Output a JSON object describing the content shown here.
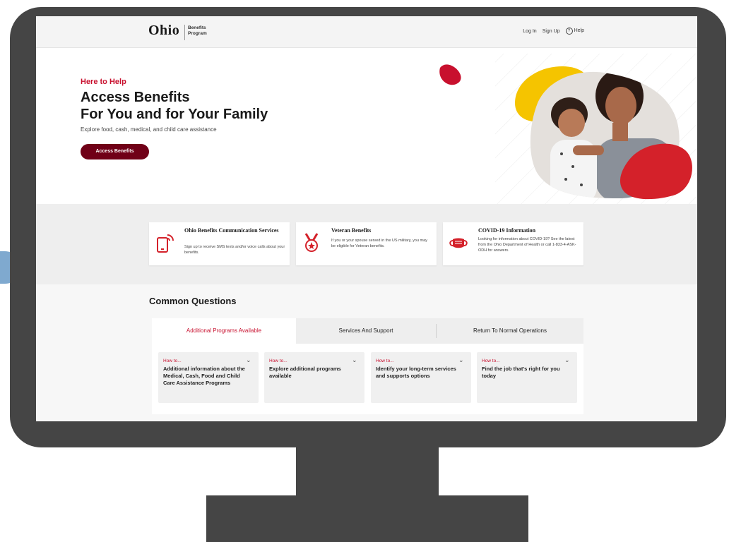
{
  "nav": {
    "logo_brand": "Ohio",
    "logo_sub_line1": "Benefits",
    "logo_sub_line2": "Program",
    "login": "Log In",
    "signup": "Sign Up",
    "help": "Help"
  },
  "hero": {
    "tagline": "Here to Help",
    "title_line1": "Access Benefits",
    "title_line2": "For You and for Your Family",
    "description": "Explore food, cash, medical, and child care assistance",
    "cta_label": "Access Benefits"
  },
  "cards": [
    {
      "title": "Ohio Benefits Communication Services",
      "description": "Sign up to receive SMS texts and/or voice calls about your benefits.",
      "icon": "phone-message-icon"
    },
    {
      "title": "Veteran Benefits",
      "description": "If you or your spouse served in the US military, you may be eligible for Veteran benefits.",
      "icon": "medal-icon"
    },
    {
      "title": "COVID-19 Information",
      "description": "Looking for information about COVID-19? See the latest from the Ohio Department of Health or call 1-833-4-ASK-ODH for answers.",
      "icon": "face-mask-icon"
    }
  ],
  "common_questions": {
    "title": "Common Questions",
    "tabs": [
      {
        "label": "Additional Programs Available",
        "active": true
      },
      {
        "label": "Services And Support",
        "active": false
      },
      {
        "label": "Return To Normal Operations",
        "active": false
      }
    ],
    "items": [
      {
        "prefix": "How to...",
        "text": "Additional information about the Medical, Cash, Food and Child Care Assistance Programs"
      },
      {
        "prefix": "How to...",
        "text": "Explore additional programs available"
      },
      {
        "prefix": "How to...",
        "text": "Identify your long-term services and supports options"
      },
      {
        "prefix": "How to...",
        "text": "Find the job that's right for you today"
      }
    ]
  },
  "colors": {
    "brand_red": "#c8102e",
    "cta_maroon": "#700017",
    "accent_yellow": "#f5c400",
    "frame_gray": "#454545"
  }
}
